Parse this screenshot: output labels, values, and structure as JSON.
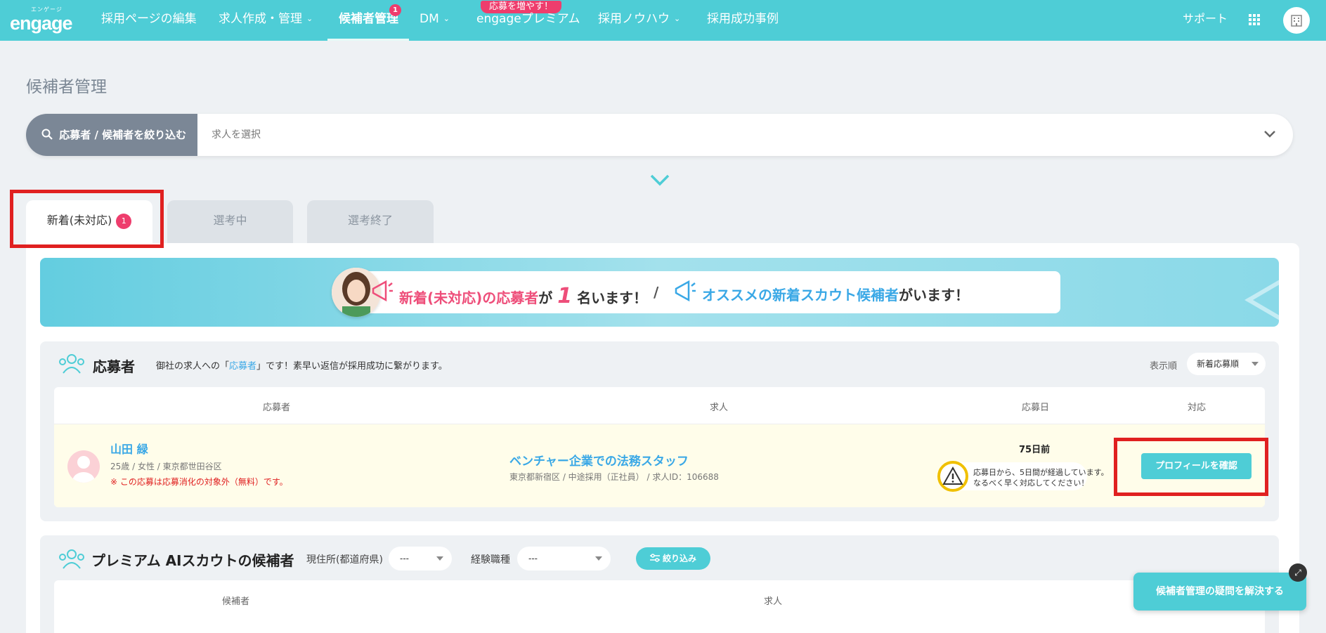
{
  "nav": {
    "logo_sub": "エンゲージ",
    "logo": "engage",
    "items": [
      {
        "label": "採用ページの編集"
      },
      {
        "label": "求人作成・管理"
      },
      {
        "label": "候補者管理",
        "badge": "1"
      },
      {
        "label": "DM"
      },
      {
        "label": "engageプレミアム",
        "promo": "応募を増やす！"
      },
      {
        "label": "採用ノウハウ"
      },
      {
        "label": "採用成功事例"
      }
    ],
    "support": "サポート"
  },
  "page_title": "候補者管理",
  "filter": {
    "button_label": "応募者 / 候補者を絞り込む",
    "select_placeholder": "求人を選択"
  },
  "tabs": [
    {
      "label": "新着(未対応)",
      "badge": "1"
    },
    {
      "label": "選考中"
    },
    {
      "label": "選考終了"
    }
  ],
  "banner": {
    "part1_pink": "新着(未対応)の応募者",
    "part1_connector": "が",
    "count": "1",
    "part1_suffix": "名います！",
    "divider": "/",
    "part2_blue": "オススメの新着スカウト候補者",
    "part2_suffix": "がいます！"
  },
  "applicants": {
    "title": "応募者",
    "desc_prefix": "御社の求人への「",
    "desc_highlight": "応募者",
    "desc_suffix": "」です！素早い返信が採用成功に繋がります。",
    "sort_label": "表示順",
    "sort_value": "新着応募順",
    "columns": [
      "応募者",
      "求人",
      "応募日",
      "対応"
    ],
    "rows": [
      {
        "name": "山田 緑",
        "meta": "25歳  /  女性  /  東京都世田谷区",
        "note": "※ この応募は応募消化の対象外（無料）です。",
        "job_title": "ベンチャー企業での法務スタッフ",
        "job_meta": "東京都新宿区  /  中途採用（正社員）  /  求人ID：106688",
        "days": "75日前",
        "warn_line1": "応募日から、5日間が経過しています。",
        "warn_line2": "なるべく早く対応してください！",
        "action": "プロフィールを確認"
      }
    ]
  },
  "premium": {
    "title": "プレミアム AIスカウトの候補者",
    "location_label": "現住所(都道府県)",
    "location_value": "---",
    "job_label": "経験職種",
    "job_value": "---",
    "narrow_button": "絞り込み",
    "columns": [
      "候補者",
      "求人"
    ]
  },
  "help_button": "候補者管理の疑問を解決する",
  "colors": {
    "brand": "#4ecdd6",
    "badge": "#ee3d6d",
    "highlight_box": "#e02020",
    "link": "#3aa8e6"
  }
}
